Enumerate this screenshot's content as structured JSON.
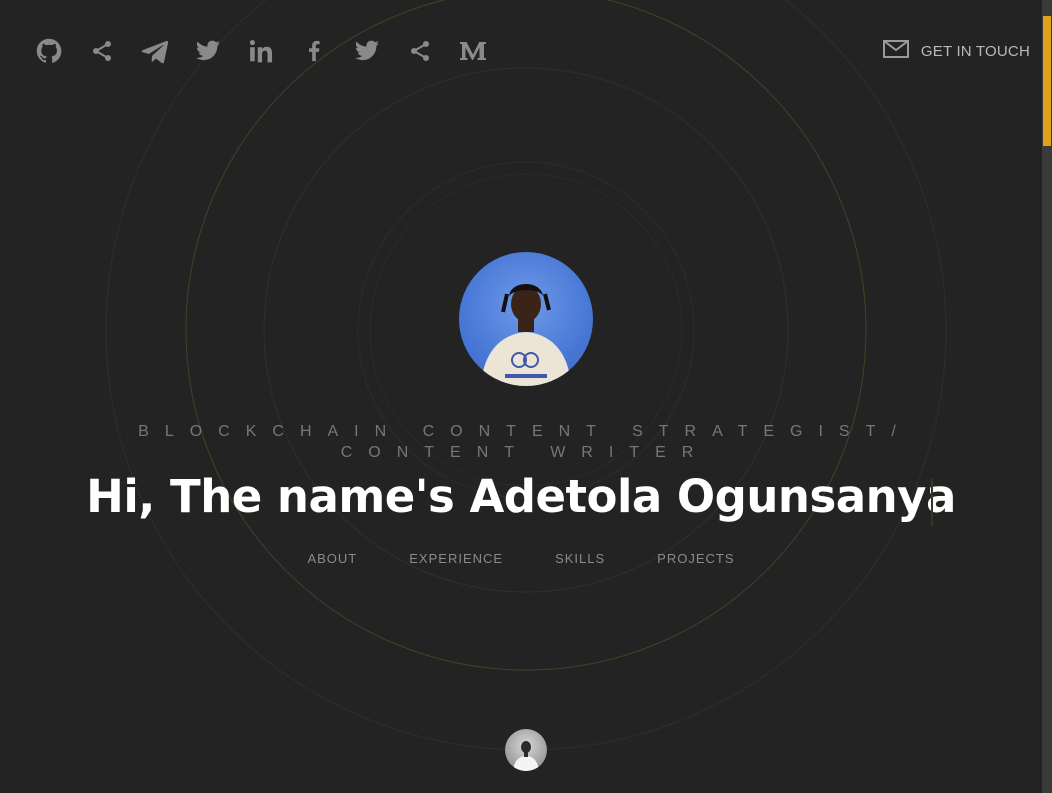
{
  "social_links": [
    {
      "name": "github",
      "icon": "github-icon"
    },
    {
      "name": "share",
      "icon": "share-icon"
    },
    {
      "name": "telegram",
      "icon": "telegram-icon"
    },
    {
      "name": "twitter",
      "icon": "twitter-icon"
    },
    {
      "name": "linkedin",
      "icon": "linkedin-icon"
    },
    {
      "name": "facebook",
      "icon": "facebook-icon"
    },
    {
      "name": "twitter-2",
      "icon": "twitter-icon"
    },
    {
      "name": "share-2",
      "icon": "share-icon"
    },
    {
      "name": "medium",
      "icon": "medium-icon"
    }
  ],
  "contact": {
    "label": "GET IN TOUCH",
    "icon": "mail-icon"
  },
  "hero": {
    "subtitle": "Blockchain Content Strategist/ Content Writer",
    "headline": "Hi, The name's Adetola Ogunsanya"
  },
  "nav": {
    "about": "ABOUT",
    "experience": "EXPERIENCE",
    "skills": "SKILLS",
    "projects": "PROJECTS"
  },
  "colors": {
    "background": "#232323",
    "accent": "#e1a21b",
    "ring": "#3a3a3a",
    "ring_gold": "#4a3f26"
  }
}
